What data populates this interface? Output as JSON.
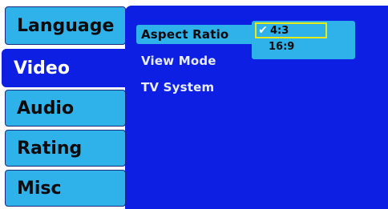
{
  "sidebar": {
    "items": [
      {
        "label": "Language",
        "active": false
      },
      {
        "label": "Video",
        "active": true
      },
      {
        "label": "Audio",
        "active": false
      },
      {
        "label": "Rating",
        "active": false
      },
      {
        "label": "Misc",
        "active": false
      }
    ]
  },
  "main": {
    "options": [
      {
        "label": "Aspect Ratio",
        "selected": true
      },
      {
        "label": "View Mode",
        "selected": false
      },
      {
        "label": "TV System",
        "selected": false
      }
    ],
    "dropdown": {
      "items": [
        {
          "label": "4:3",
          "checked": true,
          "highlighted": true
        },
        {
          "label": "16:9",
          "checked": false,
          "highlighted": false
        }
      ]
    }
  },
  "colors": {
    "accent_blue": "#0d1fe3",
    "tab_cyan": "#2fb1ea",
    "highlight_yellow": "#e6ea18"
  },
  "icons": {
    "check": "check-icon"
  }
}
